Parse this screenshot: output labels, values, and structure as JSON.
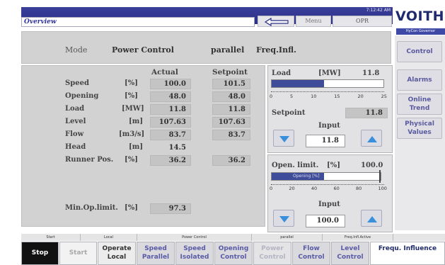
{
  "header": {
    "title": "Overview",
    "menu_label": "Menu",
    "opr_label": "OPR",
    "clock": "7:12:42 AM",
    "logo": "VOITH",
    "logo_sub": "HyCon Governor"
  },
  "mode": {
    "label": "Mode",
    "value": "Power Control",
    "parallel": "parallel",
    "freq_infl": "Freq.Infl."
  },
  "table": {
    "col_actual": "Actual",
    "col_setpoint": "Setpoint",
    "rows": [
      {
        "name": "Speed",
        "unit": "[%]",
        "actual": "100.0",
        "setpoint": "101.5"
      },
      {
        "name": "Opening",
        "unit": "[%]",
        "actual": "48.0",
        "setpoint": "48.0"
      },
      {
        "name": "Load",
        "unit": "[MW]",
        "actual": "11.8",
        "setpoint": "11.8"
      },
      {
        "name": "Level",
        "unit": "[m]",
        "actual": "107.63",
        "setpoint": "107.63"
      },
      {
        "name": "Flow",
        "unit": "[m3/s]",
        "actual": "83.7",
        "setpoint": "83.7"
      },
      {
        "name": "Head",
        "unit": "[m]",
        "actual": "14.5",
        "setpoint": ""
      },
      {
        "name": "Runner Pos.",
        "unit": "[%]",
        "actual": "36.2",
        "setpoint": "36.2"
      }
    ],
    "min_op": {
      "name": "Min.Op.limit.",
      "unit": "[%]",
      "actual": "97.3"
    }
  },
  "load_panel": {
    "label": "Load",
    "unit": "[MW]",
    "value": "11.8",
    "bar_fraction": 0.47,
    "scale": [
      "0",
      "5",
      "10",
      "15",
      "20",
      "25"
    ],
    "setpoint_label": "Setpoint",
    "setpoint_value": "11.8",
    "input_label": "Input",
    "input_value": "11.8"
  },
  "open_panel": {
    "label": "Open. limit.",
    "unit": "[%]",
    "value": "100.0",
    "bar_label": "Opening [%]",
    "bar_fraction": 0.48,
    "scale": [
      "0",
      "20",
      "40",
      "60",
      "80",
      "100"
    ],
    "input_label": "Input",
    "input_value": "100.0"
  },
  "side_buttons": [
    {
      "label": "Control"
    },
    {
      "label": "Alarms"
    },
    {
      "label": "Online Trend"
    },
    {
      "label": "Physical Values"
    }
  ],
  "status": {
    "start": "Start",
    "local": "Local",
    "power_control": "Power Control",
    "parallel": "parallel",
    "freq_infl_active": "Freq.Infl.Active"
  },
  "bottom_buttons": {
    "stop": "Stop",
    "start": "Start",
    "operate_local": "Operate Local",
    "speed_parallel": "Speed Parallel",
    "speed_isolated": "Speed Isolated",
    "opening_control": "Opening Control",
    "power_control": "Power Control",
    "flow_control": "Flow Control",
    "level_control": "Level Control",
    "frequ_influence": "Frequ. Influence"
  },
  "colors": {
    "accent": "#2a2f86",
    "bar_fill": "#3e4c9a",
    "arrow_blue": "#3a8fdc"
  }
}
